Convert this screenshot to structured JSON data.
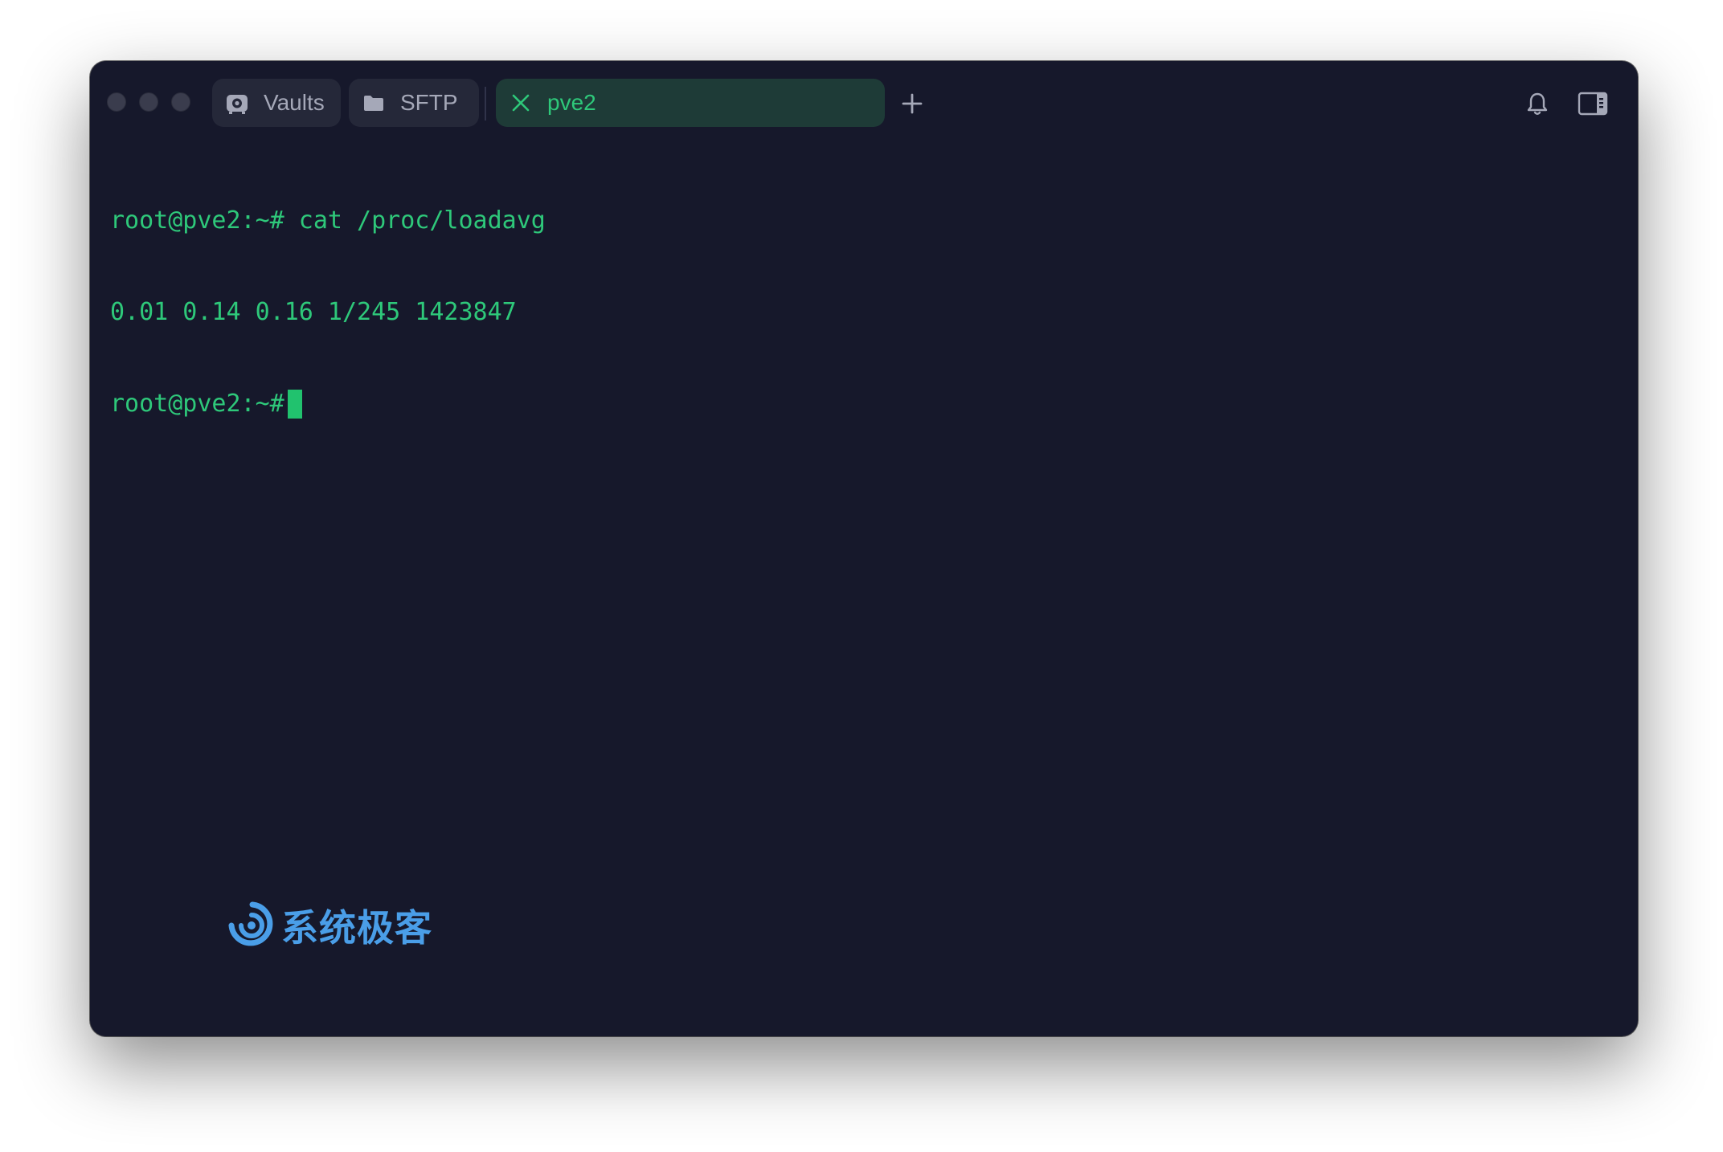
{
  "window": {
    "background": "#16182b",
    "accent": "#2ec87a"
  },
  "tabs": [
    {
      "label": "Vaults",
      "icon": "vault-icon",
      "active": false
    },
    {
      "label": "SFTP",
      "icon": "folder-icon",
      "active": false
    },
    {
      "label": "pve2",
      "icon": "close-icon",
      "active": true
    }
  ],
  "toolbar": {
    "new_tab_icon": "plus-icon",
    "notifications_icon": "bell-icon",
    "sidebar_toggle_icon": "sidebar-icon"
  },
  "terminal": {
    "lines": [
      "root@pve2:~# cat /proc/loadavg",
      "0.01 0.14 0.16 1/245 1423847",
      "root@pve2:~#"
    ]
  },
  "watermark": {
    "logo_icon": "swirl-logo-icon",
    "text": "系统极客"
  }
}
